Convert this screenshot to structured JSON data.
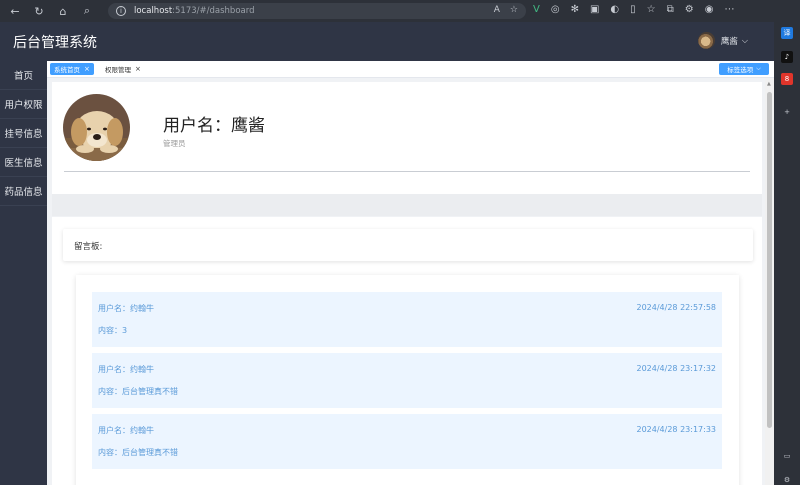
{
  "browser": {
    "url_host": "localhost",
    "url_path": ":5173/#/dashboard"
  },
  "app": {
    "title": "后台管理系统",
    "user_name": "鹰酱"
  },
  "sidebar": {
    "items": [
      {
        "label": "首页"
      },
      {
        "label": "用户权限"
      },
      {
        "label": "挂号信息"
      },
      {
        "label": "医生信息"
      },
      {
        "label": "药品信息"
      }
    ]
  },
  "tabs": {
    "items": [
      {
        "label": "系统首页"
      },
      {
        "label": "权限管理"
      }
    ],
    "options_label": "标签选项"
  },
  "profile": {
    "username_line": "用户名：鹰酱",
    "role": "管理员"
  },
  "board": {
    "title": "留言板:",
    "messages": [
      {
        "user": "用户名：约翰牛",
        "time": "2024/4/28 22:57:58",
        "content": "内容：3"
      },
      {
        "user": "用户名：约翰牛",
        "time": "2024/4/28 23:17:32",
        "content": "内容：后台管理真不错"
      },
      {
        "user": "用户名：约翰牛",
        "time": "2024/4/28 23:17:33",
        "content": "内容：后台管理真不错"
      }
    ]
  },
  "colors": {
    "header_bg": "#2f3545",
    "accent": "#409eff",
    "message_bg": "#ecf5ff",
    "message_text": "#5a9ad8"
  }
}
